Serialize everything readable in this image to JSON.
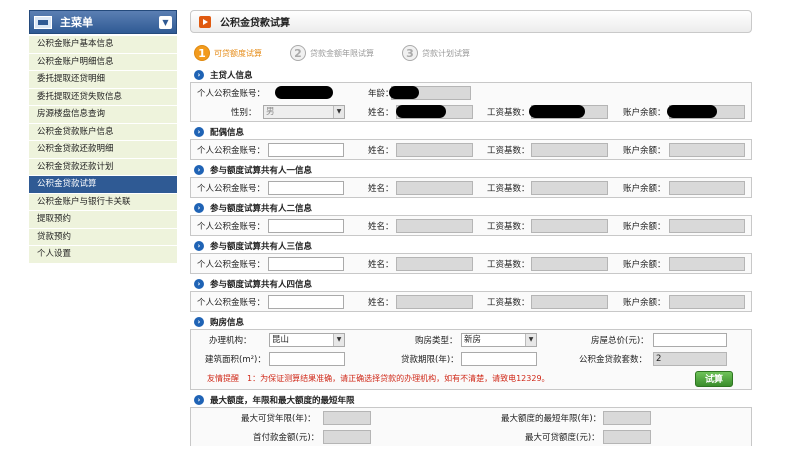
{
  "sidebar": {
    "title": "主菜单",
    "items": [
      "公积金账户基本信息",
      "公积金账户明细信息",
      "委托提取还贷明细",
      "委托提取还贷失败信息",
      "房源楼盘信息查询",
      "公积金贷款账户信息",
      "公积金贷款还款明细",
      "公积金贷款还款计划",
      "公积金贷款试算",
      "公积金账户与银行卡关联",
      "提取预约",
      "贷款预约",
      "个人设置"
    ],
    "active_index": 8
  },
  "page": {
    "title": "公积金贷款试算"
  },
  "steps": [
    {
      "num": "1",
      "label": "可贷额度试算"
    },
    {
      "num": "2",
      "label": "贷款金额年限试算"
    },
    {
      "num": "3",
      "label": "贷款计划试算"
    }
  ],
  "labels": {
    "account_no": "个人公积金账号：",
    "age": "年龄：",
    "gender": "性别：",
    "name": "姓名：",
    "wage_base": "工资基数：",
    "balance": "账户余额："
  },
  "main_borrower": {
    "heading": "主贷人信息",
    "gender_value": "男"
  },
  "spouse": {
    "heading": "配偶信息"
  },
  "co_borrowers": [
    {
      "heading": "参与额度试算共有人一信息"
    },
    {
      "heading": "参与额度试算共有人二信息"
    },
    {
      "heading": "参与额度试算共有人三信息"
    },
    {
      "heading": "参与额度试算共有人四信息"
    }
  ],
  "purchase": {
    "heading": "购房信息",
    "agency_label": "办理机构：",
    "agency_value": "昆山",
    "house_type_label": "购房类型：",
    "house_type_value": "新房",
    "total_price_label": "房屋总价(元)：",
    "area_label": "建筑面积(m²)：",
    "term_label": "贷款期限(年)：",
    "times_label": "公积金贷款套数：",
    "times_value": "2",
    "tip": "友情提醒　1：为保证测算结果准确，请正确选择贷款的办理机构，如有不清楚，请致电12329。",
    "calc_button": "试算"
  },
  "limits": {
    "heading": "最大额度，年限和最大额度的最短年限",
    "max_term_label": "最大可贷年限(年)：",
    "min_term_label": "最大额度的最短年限(年)：",
    "down_payment_label": "首付款金额(元)：",
    "max_amount_label": "最大可贷额度(元)："
  },
  "colors": {
    "menu_header": "#2f5a94",
    "step_active": "#f29b1e",
    "tip_text": "#d02a1a",
    "button": "#3a8d2b"
  }
}
